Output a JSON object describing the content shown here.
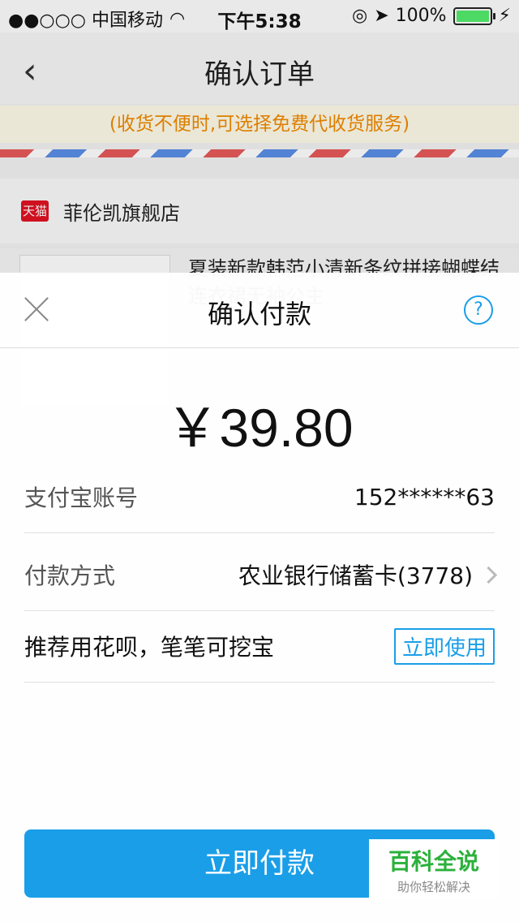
{
  "status_bar": {
    "carrier": "●●○○○ 中国移动",
    "time": "下午5:38",
    "battery": "100%"
  },
  "background_page": {
    "nav_title": "确认订单",
    "back_icon": "chevron-left-icon",
    "notice": "(收货不便时,可选择免费代收货服务)",
    "shop_badge": "天猫",
    "shop_name": "菲伦凯旗舰店",
    "product_title": "夏装新款韩范小清新条纹拼接蝴蝶结连衣裙无袖公主"
  },
  "sheet": {
    "title": "确认付款",
    "amount": "￥39.80",
    "rows": [
      {
        "label": "支付宝账号",
        "value": "152******63"
      },
      {
        "label": "付款方式",
        "value": "农业银行储蓄卡(3778)"
      },
      {
        "label": "推荐用花呗，笔笔可挖宝",
        "value": "立即使用"
      }
    ],
    "pay_button": "立即付款"
  },
  "watermark": {
    "main": "百科全说",
    "sub": "助你轻松解决"
  },
  "colors": {
    "accent": "#1a9ee8",
    "notice": "#f08a00",
    "brand_tmall": "#e01222",
    "watermark": "#2bb13c"
  }
}
